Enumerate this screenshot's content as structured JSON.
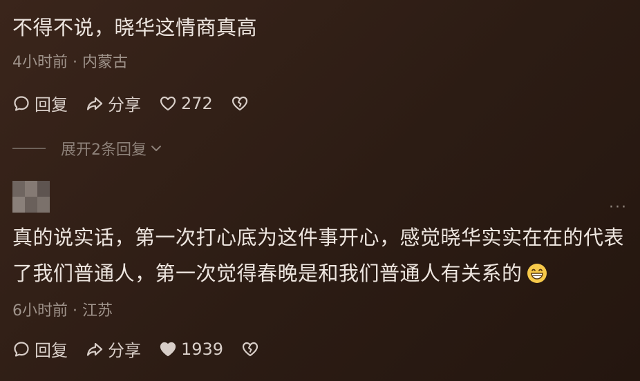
{
  "comment1": {
    "text": "不得不说，晓华这情商真高",
    "time": "4小时前",
    "location": "内蒙古",
    "reply_label": "回复",
    "share_label": "分享",
    "like_count": "272",
    "expand_label": "展开2条回复"
  },
  "comment2": {
    "text": "真的说实话，第一次打心底为这件事开心，感觉晓华实实在在的代表了我们普通人，第一次觉得春晚是和我们普通人有关系的",
    "time": "6小时前",
    "location": "江苏",
    "reply_label": "回复",
    "share_label": "分享",
    "like_count": "1939",
    "more_label": "···"
  },
  "separator": " · ",
  "icons": {
    "reply": "comment-bubble-icon",
    "share": "share-arrow-icon",
    "like": "heart-icon",
    "dislike": "broken-heart-icon",
    "expand": "chevron-down-icon",
    "emoji": "grinning-face-emoji"
  }
}
